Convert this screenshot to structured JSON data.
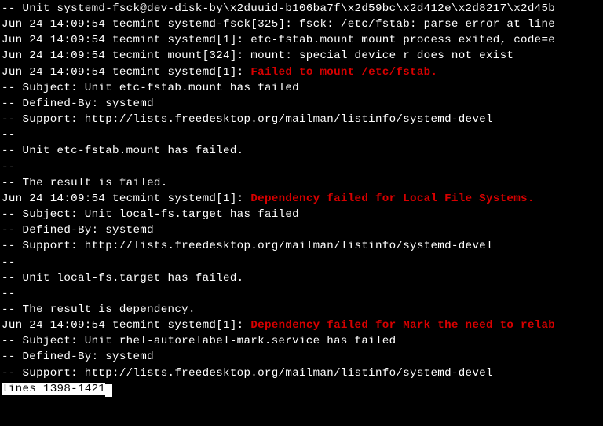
{
  "lines": [
    {
      "parts": [
        {
          "t": "-- Unit systemd-fsck@dev-disk-by\\x2duuid-b106ba7f\\x2d59bc\\x2d412e\\x2d8217\\x2d45b"
        }
      ]
    },
    {
      "parts": [
        {
          "t": "Jun 24 14:09:54 tecmint systemd-fsck[325]: fsck: /etc/fstab: parse error at line"
        }
      ]
    },
    {
      "parts": [
        {
          "t": "Jun 24 14:09:54 tecmint systemd[1]: etc-fstab.mount mount process exited, code=e"
        }
      ]
    },
    {
      "parts": [
        {
          "t": "Jun 24 14:09:54 tecmint mount[324]: mount: special device r does not exist"
        }
      ]
    },
    {
      "parts": [
        {
          "t": "Jun 24 14:09:54 tecmint systemd[1]: "
        },
        {
          "t": "Failed to mount /etc/fstab.",
          "red": true
        }
      ]
    },
    {
      "parts": [
        {
          "t": "-- Subject: Unit etc-fstab.mount has failed"
        }
      ]
    },
    {
      "parts": [
        {
          "t": "-- Defined-By: systemd"
        }
      ]
    },
    {
      "parts": [
        {
          "t": "-- Support: http://lists.freedesktop.org/mailman/listinfo/systemd-devel"
        }
      ]
    },
    {
      "parts": [
        {
          "t": "--"
        }
      ]
    },
    {
      "parts": [
        {
          "t": "-- Unit etc-fstab.mount has failed."
        }
      ]
    },
    {
      "parts": [
        {
          "t": "--"
        }
      ]
    },
    {
      "parts": [
        {
          "t": "-- The result is failed."
        }
      ]
    },
    {
      "parts": [
        {
          "t": "Jun 24 14:09:54 tecmint systemd[1]: "
        },
        {
          "t": "Dependency failed for Local File Systems.",
          "red": true
        }
      ]
    },
    {
      "parts": [
        {
          "t": "-- Subject: Unit local-fs.target has failed"
        }
      ]
    },
    {
      "parts": [
        {
          "t": "-- Defined-By: systemd"
        }
      ]
    },
    {
      "parts": [
        {
          "t": "-- Support: http://lists.freedesktop.org/mailman/listinfo/systemd-devel"
        }
      ]
    },
    {
      "parts": [
        {
          "t": "--"
        }
      ]
    },
    {
      "parts": [
        {
          "t": "-- Unit local-fs.target has failed."
        }
      ]
    },
    {
      "parts": [
        {
          "t": "--"
        }
      ]
    },
    {
      "parts": [
        {
          "t": "-- The result is dependency."
        }
      ]
    },
    {
      "parts": [
        {
          "t": "Jun 24 14:09:54 tecmint systemd[1]: "
        },
        {
          "t": "Dependency failed for Mark the need to relab",
          "red": true
        }
      ]
    },
    {
      "parts": [
        {
          "t": "-- Subject: Unit rhel-autorelabel-mark.service has failed"
        }
      ]
    },
    {
      "parts": [
        {
          "t": "-- Defined-By: systemd"
        }
      ]
    },
    {
      "parts": [
        {
          "t": "-- Support: http://lists.freedesktop.org/mailman/listinfo/systemd-devel"
        }
      ]
    }
  ],
  "status": "lines 1398-1421"
}
